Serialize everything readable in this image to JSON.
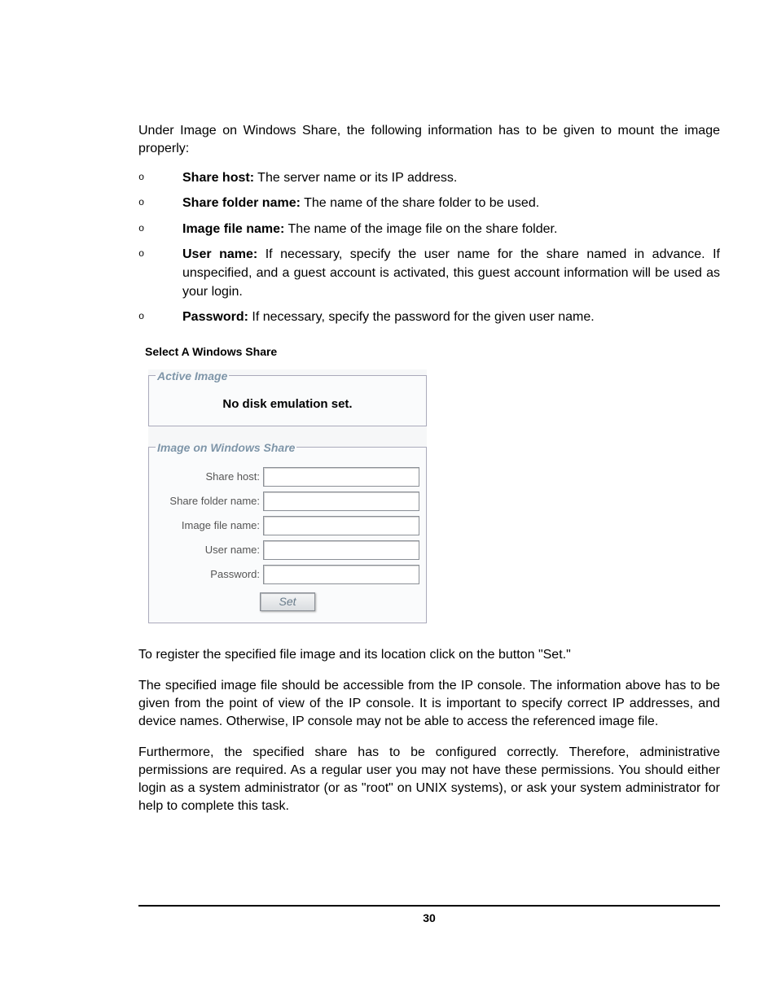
{
  "intro": "Under Image on Windows Share, the following information has to be given to mount the image properly:",
  "bullets": [
    {
      "label": "Share host:",
      "text": " The server name or its IP address."
    },
    {
      "label": "Share folder name:",
      "text": " The name of the share folder to be used."
    },
    {
      "label": "Image file name:",
      "text": " The name of the image file on the share folder."
    },
    {
      "label": "User name:",
      "text": " If necessary, specify the user name for the share named in advance. If unspecified, and a guest account is activated, this guest account information will be used as your login."
    },
    {
      "label": "Password:",
      "text": " If necessary, specify the password for the given user name."
    }
  ],
  "figure_caption": "Select A Windows Share",
  "ui": {
    "active_legend": "Active Image",
    "active_message": "No disk emulation set.",
    "share_legend": "Image on Windows Share",
    "fields": {
      "share_host": {
        "label": "Share host:",
        "value": ""
      },
      "folder": {
        "label": "Share folder name:",
        "value": ""
      },
      "image_file": {
        "label": "Image file name:",
        "value": ""
      },
      "user": {
        "label": "User name:",
        "value": ""
      },
      "password": {
        "label": "Password:",
        "value": ""
      }
    },
    "set_button": "Set"
  },
  "para1": "To register the specified file image and its location click on the button \"Set.\"",
  "para2": "The specified image file should be accessible from the IP console. The information above has to be given from the point of view of the IP console. It is important to specify correct IP addresses, and device names. Otherwise, IP console may not be able to access the referenced image file.",
  "para3": "Furthermore, the specified share has to be configured correctly. Therefore, administrative permissions are required. As a regular user you may not have these permissions. You should either login as a system administrator (or as \"root\" on UNIX systems), or ask your system administrator for help to complete this task.",
  "page_number": "30"
}
